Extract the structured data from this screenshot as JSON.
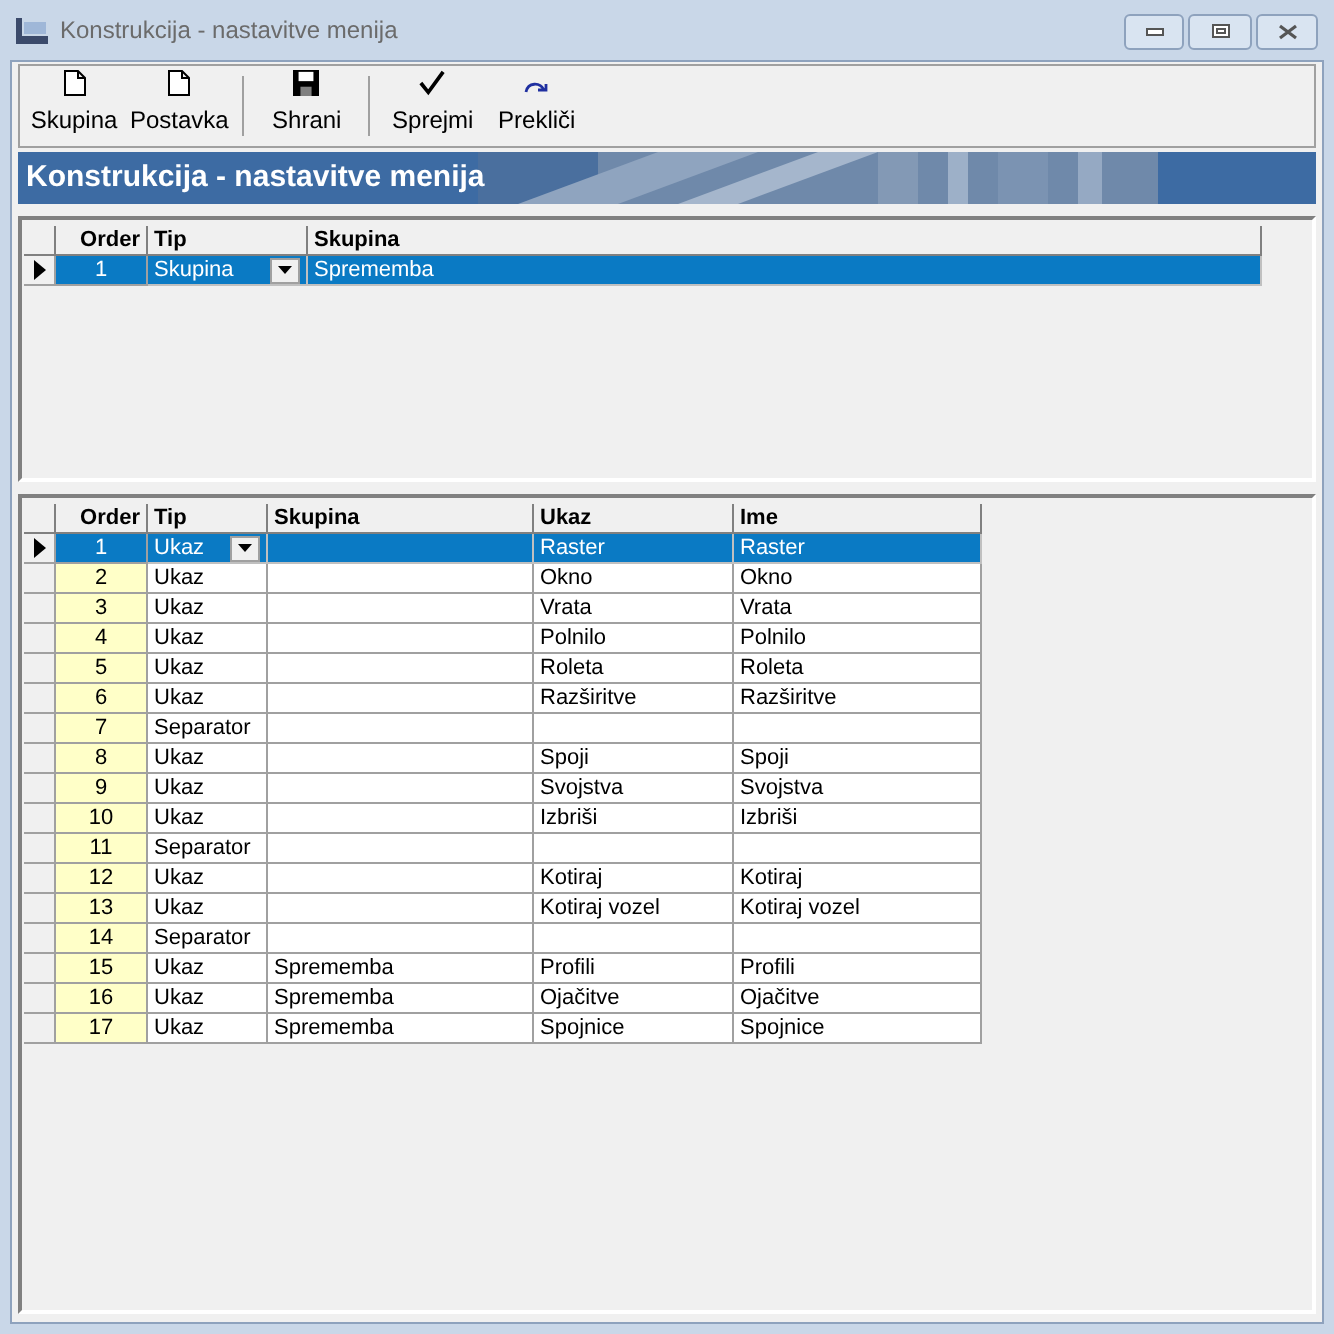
{
  "window": {
    "title": "Konstrukcija - nastavitve menija"
  },
  "toolbar": [
    {
      "label": "Skupina",
      "kind": "new"
    },
    {
      "label": "Postavka",
      "kind": "new"
    },
    {
      "label": "Shrani",
      "kind": "save"
    },
    {
      "label": "Sprejmi",
      "kind": "accept"
    },
    {
      "label": "Prekliči",
      "kind": "undo"
    }
  ],
  "banner": {
    "title": "Konstrukcija - nastavitve menija"
  },
  "groups_grid": {
    "columns": [
      "Order",
      "Tip",
      "Skupina"
    ],
    "rows": [
      {
        "order": "1",
        "tip": "Skupina",
        "skupina": "Sprememba",
        "selected": true
      }
    ]
  },
  "items_grid": {
    "columns": [
      "Order",
      "Tip",
      "Skupina",
      "Ukaz",
      "Ime"
    ],
    "rows": [
      {
        "order": "1",
        "tip": "Ukaz",
        "skupina": "",
        "ukaz": "Raster",
        "ime": "Raster",
        "selected": true
      },
      {
        "order": "2",
        "tip": "Ukaz",
        "skupina": "",
        "ukaz": "Okno",
        "ime": "Okno",
        "selected": false
      },
      {
        "order": "3",
        "tip": "Ukaz",
        "skupina": "",
        "ukaz": "Vrata",
        "ime": "Vrata",
        "selected": false
      },
      {
        "order": "4",
        "tip": "Ukaz",
        "skupina": "",
        "ukaz": "Polnilo",
        "ime": "Polnilo",
        "selected": false
      },
      {
        "order": "5",
        "tip": "Ukaz",
        "skupina": "",
        "ukaz": "Roleta",
        "ime": "Roleta",
        "selected": false
      },
      {
        "order": "6",
        "tip": "Ukaz",
        "skupina": "",
        "ukaz": "Razširitve",
        "ime": "Razširitve",
        "selected": false
      },
      {
        "order": "7",
        "tip": "Separator",
        "skupina": "",
        "ukaz": "",
        "ime": "",
        "selected": false
      },
      {
        "order": "8",
        "tip": "Ukaz",
        "skupina": "",
        "ukaz": "Spoji",
        "ime": "Spoji",
        "selected": false
      },
      {
        "order": "9",
        "tip": "Ukaz",
        "skupina": "",
        "ukaz": "Svojstva",
        "ime": "Svojstva",
        "selected": false
      },
      {
        "order": "10",
        "tip": "Ukaz",
        "skupina": "",
        "ukaz": "Izbriši",
        "ime": "Izbriši",
        "selected": false
      },
      {
        "order": "11",
        "tip": "Separator",
        "skupina": "",
        "ukaz": "",
        "ime": "",
        "selected": false
      },
      {
        "order": "12",
        "tip": "Ukaz",
        "skupina": "",
        "ukaz": "Kotiraj",
        "ime": "Kotiraj",
        "selected": false
      },
      {
        "order": "13",
        "tip": "Ukaz",
        "skupina": "",
        "ukaz": "Kotiraj vozel",
        "ime": "Kotiraj vozel",
        "selected": false
      },
      {
        "order": "14",
        "tip": "Separator",
        "skupina": "",
        "ukaz": "",
        "ime": "",
        "selected": false
      },
      {
        "order": "15",
        "tip": "Ukaz",
        "skupina": "Sprememba",
        "ukaz": "Profili",
        "ime": "Profili",
        "selected": false
      },
      {
        "order": "16",
        "tip": "Ukaz",
        "skupina": "Sprememba",
        "ukaz": "Ojačitve",
        "ime": "Ojačitve",
        "selected": false
      },
      {
        "order": "17",
        "tip": "Ukaz",
        "skupina": "Sprememba",
        "ukaz": "Spojnice",
        "ime": "Spojnice",
        "selected": false
      }
    ]
  }
}
